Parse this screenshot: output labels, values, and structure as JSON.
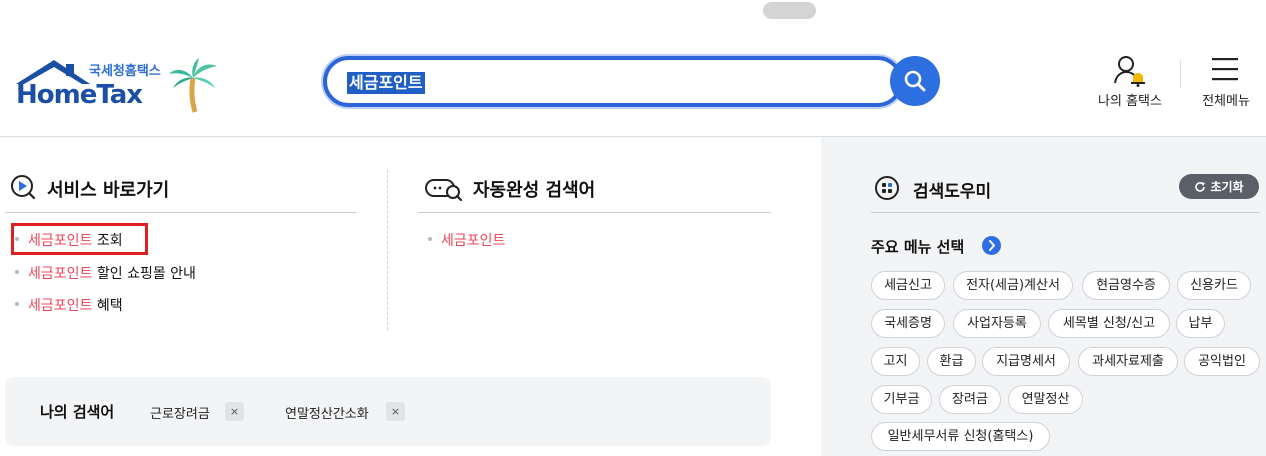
{
  "header": {
    "logo_sub": "국세청홈택스",
    "logo_main": "HomeTax",
    "search_value": "세금포인트",
    "my_hometax_label": "나의 홈택스",
    "all_menu_label": "전체메뉴"
  },
  "service_shortcuts": {
    "title": "서비스 바로가기",
    "items": [
      {
        "highlight": "세금포인트",
        "rest": " 조회"
      },
      {
        "highlight": "세금포인트",
        "rest": " 할인 쇼핑몰 안내"
      },
      {
        "highlight": "세금포인트",
        "rest": " 혜택"
      }
    ]
  },
  "autocomplete": {
    "title": "자동완성 검색어",
    "items": [
      {
        "highlight": "세금포인트",
        "rest": ""
      }
    ]
  },
  "recent_searches": {
    "title": "나의 검색어",
    "items": [
      "근로장려금",
      "연말정산간소화"
    ],
    "remove_symbol": "×"
  },
  "search_helper": {
    "title": "검색도우미",
    "reset_label": "초기화",
    "menu_select_label": "주요 메뉴 선택",
    "chips": [
      "세금신고",
      "전자(세금)계산서",
      "현금영수증",
      "신용카드",
      "국세증명",
      "사업자등록",
      "세목별 신청/신고",
      "납부",
      "고지",
      "환급",
      "지급명세서",
      "과세자료제출",
      "공익법인",
      "기부금",
      "장려금",
      "연말정산",
      "일반세무서류 신청(홈택스)"
    ]
  },
  "colors": {
    "accent": "#2d6ee0",
    "highlight": "#e8475a",
    "annotation_box": "#e02020"
  }
}
